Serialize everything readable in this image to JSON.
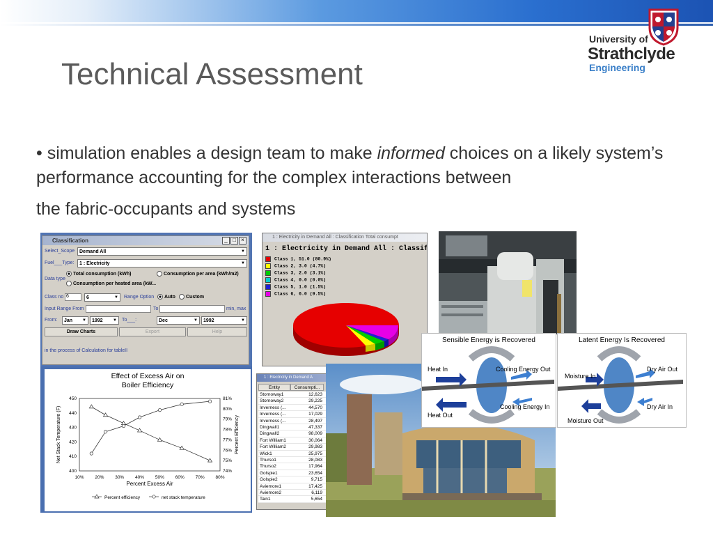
{
  "slide": {
    "title": "Technical Assessment",
    "bullet": "•",
    "body_part1": " simulation enables a design team to make ",
    "body_emph": "informed",
    "body_part2": " choices on a likely system’s performance accounting for the complex interactions between",
    "body_part3": "the fabric-occupants and systems"
  },
  "logo": {
    "line1": "University of",
    "line2": "Strathclyde",
    "line3": "Engineering"
  },
  "classification": {
    "window_title": "Classification",
    "select_scope_label": "Select_Scope",
    "select_scope_value": "Demand All",
    "fuel_type_label": "Fuel___Type:",
    "fuel_type_value": "1 : Electricity",
    "data_type_label": "Data type",
    "opt_total": "Total consumption (kWh)",
    "opt_per_area": "Consumption per area (kWh/m2)",
    "opt_per_heated": "Consumption per heated area (kW...",
    "class_no_label": "Class no",
    "class_no_value": "6",
    "class_no_select": "6",
    "range_option_label": "Range Option",
    "opt_auto": "Auto",
    "opt_custom": "Custom",
    "input_range_label": "Input Range  From",
    "to_label": "To",
    "min_max_label": "min, max",
    "from_label": "From:",
    "from_month": "Jan",
    "from_year": "1992",
    "to_label2": "To___:",
    "to_month": "Dec",
    "to_year": "1992",
    "draw_charts": "Draw Charts",
    "export": "Export",
    "help": "Help",
    "status": "in the process of Calculation for tableII",
    "btn_min": "_",
    "btn_max": "□",
    "btn_close": "×"
  },
  "pie_window": {
    "title": "1 : Electricity in Demand All : Classification Total consumpt",
    "heading": "1 : Electricity in Demand All : Classifi",
    "legend": [
      {
        "label": "Class 1, 51.0 (80.9%)",
        "color": "#e60000"
      },
      {
        "label": "Class 2, 3.0 (4.7%)",
        "color": "#ffff00"
      },
      {
        "label": "Class 3, 2.0 (3.1%)",
        "color": "#00cc00"
      },
      {
        "label": "Class 4, 0.0 (0.0%)",
        "color": "#00cccc"
      },
      {
        "label": "Class 5, 1.0 (1.5%)",
        "color": "#1f1fd6"
      },
      {
        "label": "Class 6, 6.0 (9.5%)",
        "color": "#e600e6"
      }
    ]
  },
  "table_window": {
    "title": "1 : Electricity in Demand A",
    "col_entity": "Entity",
    "col_consumption": "Consumpti...",
    "rows": [
      {
        "entity": "Stornoway1",
        "value": "12,623"
      },
      {
        "entity": "Stornoway2",
        "value": "29,225"
      },
      {
        "entity": "Inverness (...",
        "value": "44,570"
      },
      {
        "entity": "Inverness (...",
        "value": "17,029"
      },
      {
        "entity": "Inverness (...",
        "value": "28,497"
      },
      {
        "entity": "Dingwall1",
        "value": "47,337"
      },
      {
        "entity": "Dingwall2",
        "value": "98,009"
      },
      {
        "entity": "Fort William1",
        "value": "30,064"
      },
      {
        "entity": "Fort William2",
        "value": "29,983"
      },
      {
        "entity": "Wick1",
        "value": "25,975"
      },
      {
        "entity": "Thurso1",
        "value": "28,083"
      },
      {
        "entity": "Thurso2",
        "value": "17,964"
      },
      {
        "entity": "Golspie1",
        "value": "23,654"
      },
      {
        "entity": "Golspie2",
        "value": "9,715"
      },
      {
        "entity": "Aviemore1",
        "value": "17,425"
      },
      {
        "entity": "Aviemore2",
        "value": "6,119"
      },
      {
        "entity": "Tain1",
        "value": "5,654"
      }
    ]
  },
  "energy_diagrams": {
    "sensible": {
      "title": "Sensible Energy is Recovered",
      "heat_in": "Heat  In",
      "heat_out": "Heat Out",
      "cooling_out": "Cooling Energy Out",
      "cooling_in": "Cooling Energy In"
    },
    "latent": {
      "title": "Latent Energy Is Recovered",
      "moisture_in": "Moisture In",
      "moisture_out": "Moisture Out",
      "dry_air_out": "Dry Air Out",
      "dry_air_in": "Dry Air In"
    }
  },
  "chart_data": {
    "type": "line",
    "title": "Effect of Excess Air on Boiler Efficiency",
    "title_line1": "Effect of Excess Air on",
    "title_line2": "Boiler Efficiency",
    "xlabel": "Percent Excess Air",
    "ylabel_left": "Net Stack Temperature (F)",
    "ylabel_right": "Percent Efficiency",
    "x_ticks": [
      "10%",
      "20%",
      "30%",
      "40%",
      "50%",
      "60%",
      "70%",
      "80%"
    ],
    "y_left_ticks": [
      "400",
      "410",
      "420",
      "430",
      "440",
      "450"
    ],
    "y_right_ticks": [
      "74%",
      "75%",
      "76%",
      "77%",
      "78%",
      "79%",
      "80%",
      "81%"
    ],
    "xlim": [
      10,
      80
    ],
    "ylim_left": [
      400,
      450
    ],
    "ylim_right": [
      74,
      81
    ],
    "series": [
      {
        "name": "Percent efficiency",
        "axis": "right",
        "x": [
          16,
          23,
          32,
          40,
          50,
          61,
          75
        ],
        "values": [
          80.2,
          79.4,
          78.6,
          77.9,
          77.0,
          76.2,
          75.0
        ]
      },
      {
        "name": "net stack temperature",
        "axis": "left",
        "x": [
          16,
          23,
          32,
          40,
          50,
          61,
          75
        ],
        "values": [
          412,
          427,
          431,
          437,
          442,
          446,
          448
        ]
      }
    ],
    "legend_position": "bottom"
  }
}
